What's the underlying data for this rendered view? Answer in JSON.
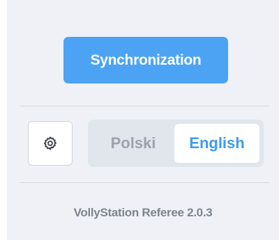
{
  "sync": {
    "label": "Synchronization"
  },
  "settings": {
    "icon": "gear-icon"
  },
  "language": {
    "options": [
      {
        "label": "Polski",
        "selected": false
      },
      {
        "label": "English",
        "selected": true
      }
    ]
  },
  "footer": {
    "version_text": "VollyStation Referee 2.0.3"
  },
  "colors": {
    "accent": "#4ca3f4",
    "selected_text": "#3f9af0",
    "panel_bg": "#eff1f6"
  }
}
